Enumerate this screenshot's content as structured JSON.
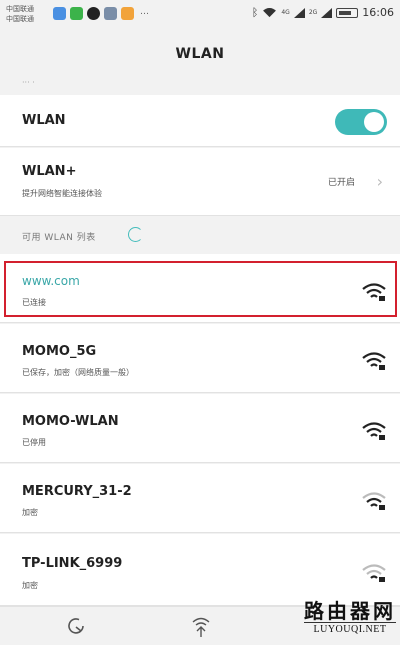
{
  "status_bar": {
    "carrier_1": "中国联通",
    "carrier_2": "中国联通",
    "network_4g": "4G",
    "network_2g": "2G",
    "time": "16:06"
  },
  "header": {
    "title": "WLAN"
  },
  "wlan_toggle": {
    "label": "WLAN",
    "on": true,
    "color": "#3fb9b8"
  },
  "wlan_plus": {
    "label": "WLAN+",
    "subtitle": "提升网络智能连接体验",
    "state": "已开启"
  },
  "available_section": {
    "label": "可用 WLAN 列表"
  },
  "networks": [
    {
      "ssid": "www.com",
      "status": "已连接",
      "icon": "wifi-locked-icon",
      "highlighted": true
    },
    {
      "ssid": "MOMO_5G",
      "status": "已保存，加密（网络质量一般）",
      "icon": "wifi-locked-icon"
    },
    {
      "ssid": "MOMO-WLAN",
      "status": "已停用",
      "icon": "wifi-locked-icon"
    },
    {
      "ssid": "MERCURY_31-2",
      "status": "加密",
      "icon": "wifi-locked-icon"
    },
    {
      "ssid": "TP-LINK_6999",
      "status": "加密",
      "icon": "wifi-locked-icon"
    }
  ],
  "bottom_bar": {
    "icons": [
      "refresh-icon",
      "wifi-direct-icon"
    ]
  },
  "watermark": {
    "cn": "路由器网",
    "en": "LUYOUQI.NET"
  },
  "colors": {
    "accent": "#3fb9b8",
    "highlight_border": "#d3202e"
  }
}
